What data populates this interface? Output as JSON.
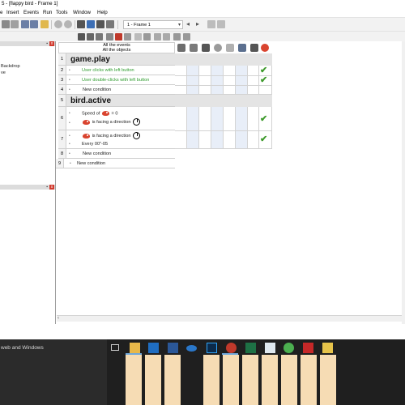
{
  "window": {
    "title": "5 - [flappy bird - Frame 1]"
  },
  "menu": [
    "e",
    "Insert",
    "Events",
    "Run",
    "Tools",
    "Window",
    "Help"
  ],
  "toolbar": {
    "frame_select": "1 - Frame 1"
  },
  "left_panel": {
    "lines": [
      "Backdrop",
      "ve"
    ]
  },
  "editor": {
    "header": {
      "line1": "All the events",
      "line2": "All the objects"
    },
    "groups": [
      {
        "num": "1",
        "title": "game.play"
      },
      {
        "num": "5",
        "title": "bird.active"
      }
    ],
    "rows": {
      "r2": {
        "num": "2",
        "text": "User clicks with left button"
      },
      "r3": {
        "num": "3",
        "text": "User double-clicks with left button"
      },
      "r4": {
        "num": "4",
        "text": "New condition"
      },
      "r6": {
        "num": "6",
        "speed_prefix": "Speed of",
        "speed_suffix": "= 0",
        "facing": "is facing a direction"
      },
      "r7": {
        "num": "7",
        "facing": "is facing a direction",
        "every": "Every 00\"-05"
      },
      "r8": {
        "num": "8",
        "text": "New condition"
      },
      "r9": {
        "num": "9",
        "text": "New condition"
      }
    }
  },
  "taskbar": {
    "search_text": "web and Windows",
    "icons": [
      "task-view-icon",
      "file-explorer-icon",
      "outlook-icon",
      "word-icon",
      "onedrive-icon",
      "photoshop-icon",
      "clickteam-icon",
      "excel-icon",
      "store-icon",
      "chrome-icon",
      "acrobat-icon",
      "clickteam-fusion-icon"
    ]
  },
  "colors": {
    "accent": "#2e9c2e",
    "taskbar": "#1f1f1f",
    "alt_column": "#e8eef8"
  }
}
